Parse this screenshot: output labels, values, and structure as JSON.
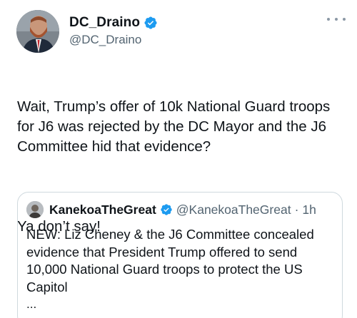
{
  "author": {
    "display_name": "DC_Draino",
    "handle": "@DC_Draino",
    "verified": true,
    "avatar": "person-with-beard-avatar"
  },
  "tweet": {
    "paragraph_1": "Wait, Trump’s offer of 10k National Guard troops for J6 was rejected by the DC Mayor and the J6 Committee hid that evidence?",
    "paragraph_2": "Ya don’t say!"
  },
  "more_options_icon": "more-horizontal-icon",
  "quoted_tweet": {
    "display_name": "KanekoaTheGreat",
    "handle": "@KanekoaTheGreat",
    "separator": "·",
    "time": "1h",
    "verified": true,
    "text": "NEW: Liz Cheney & the J6 Committee concealed evidence that President Trump offered to send 10,000 National Guard troops to protect the US Capitol",
    "ellipsis": "..."
  },
  "colors": {
    "text_primary": "#0f1419",
    "text_secondary": "#536471",
    "verified_blue": "#1d9bf0",
    "border": "#cfd9de"
  }
}
